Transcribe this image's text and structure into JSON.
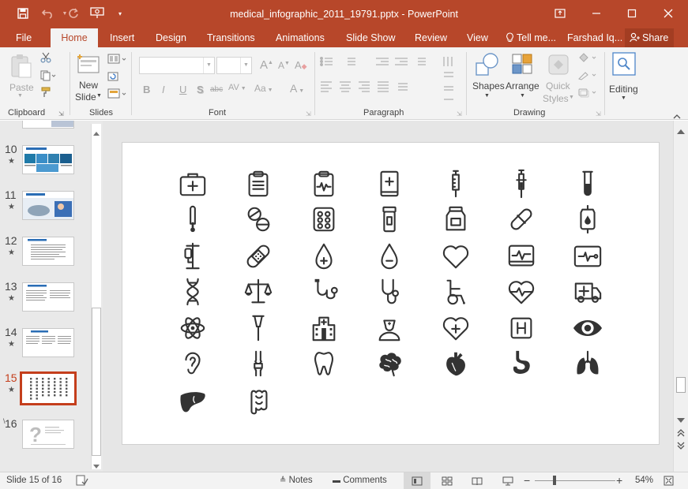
{
  "window": {
    "title": "medical_infographic_2011_19791.pptx - PowerPoint",
    "accent_color": "#b7472a"
  },
  "tabs": [
    {
      "label": "File"
    },
    {
      "label": "Home"
    },
    {
      "label": "Insert"
    },
    {
      "label": "Design"
    },
    {
      "label": "Transitions"
    },
    {
      "label": "Animations"
    },
    {
      "label": "Slide Show"
    },
    {
      "label": "Review"
    },
    {
      "label": "View"
    }
  ],
  "tell_me": "Tell me...",
  "user": "Farshad Iq...",
  "share": "Share",
  "ribbon": {
    "clipboard": {
      "label": "Clipboard",
      "paste": "Paste"
    },
    "slides": {
      "label": "Slides",
      "new_slide_1": "New",
      "new_slide_2": "Slide"
    },
    "font": {
      "label": "Font",
      "bold": "B",
      "italic": "I",
      "underline": "U",
      "shadow": "S",
      "strike": "abc",
      "spacing": "AV",
      "case": "Aa",
      "color": "A"
    },
    "paragraph": {
      "label": "Paragraph"
    },
    "drawing": {
      "label": "Drawing",
      "shapes": "Shapes",
      "arrange": "Arrange",
      "quick_1": "Quick",
      "quick_2": "Styles"
    },
    "editing": {
      "label": "Editing"
    }
  },
  "slides": [
    {
      "num": "10",
      "star": "★"
    },
    {
      "num": "11",
      "star": "★"
    },
    {
      "num": "12",
      "star": "★"
    },
    {
      "num": "13",
      "star": "★"
    },
    {
      "num": "14",
      "star": "★"
    },
    {
      "num": "15",
      "star": "★"
    },
    {
      "num": "16",
      "star": ""
    }
  ],
  "slide_icons": [
    "first-aid-kit-icon",
    "clipboard-icon",
    "medical-report-icon",
    "medical-book-icon",
    "syringe-icon",
    "injection-icon",
    "test-tube-icon",
    "thermometer-icon",
    "pills-icon",
    "pill-blister-icon",
    "medicine-bottle-icon",
    "medicine-jar-icon",
    "capsule-icon",
    "iv-bag-icon",
    "iv-stand-icon",
    "bandage-icon",
    "blood-drop-plus-icon",
    "blood-drop-minus-icon",
    "heart-icon",
    "heart-monitor-icon",
    "ecg-display-icon",
    "dna-icon",
    "scales-icon",
    "stethoscope-icon",
    "stethoscope-2-icon",
    "wheelchair-icon",
    "heartbeat-icon",
    "ambulance-icon",
    "atom-icon",
    "scalpel-icon",
    "hospital-icon",
    "nurse-icon",
    "heart-plus-icon",
    "hospital-sign-icon",
    "eye-icon",
    "ear-icon",
    "bone-icon",
    "tooth-icon",
    "brain-icon",
    "anatomical-heart-icon",
    "stomach-icon",
    "lungs-icon",
    "liver-icon",
    "intestine-icon"
  ],
  "status": {
    "slide_info": "Slide 15 of 16",
    "notes": "Notes",
    "comments": "Comments",
    "zoom": "54%"
  }
}
